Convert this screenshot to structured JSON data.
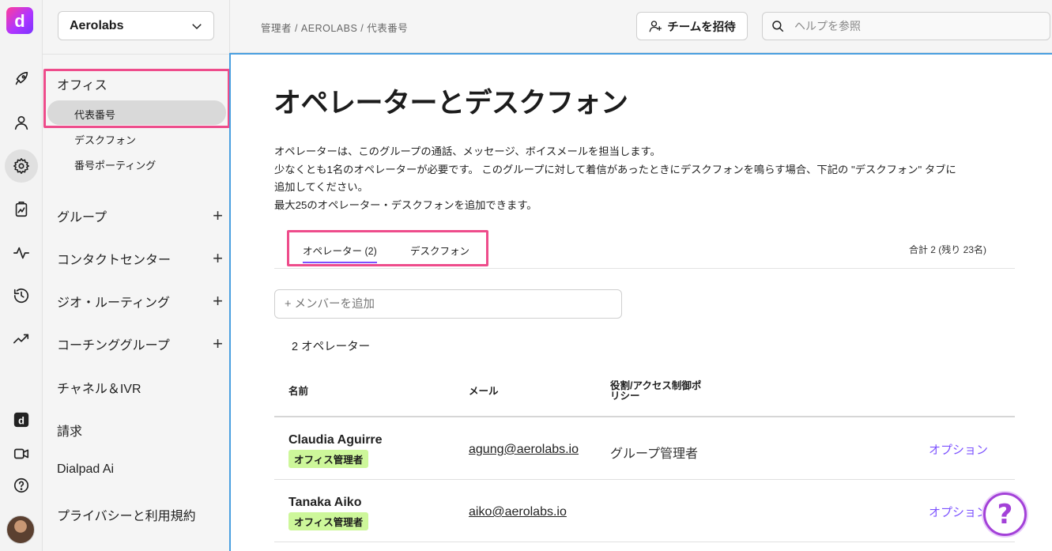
{
  "rail": {
    "logo_letter": "d"
  },
  "nav": {
    "org_name": "Aerolabs",
    "office_section": "オフィス",
    "office_items": [
      "代表番号",
      "デスクフォン",
      "番号ポーティング"
    ],
    "groups": [
      "グループ",
      "コンタクトセンター",
      "ジオ・ルーティング",
      "コーチンググループ"
    ],
    "links": [
      "チャネル＆IVR",
      "請求",
      "Dialpad Ai",
      "プライバシーと利用規約"
    ]
  },
  "topbar": {
    "breadcrumb": "管理者 / AEROLABS / 代表番号",
    "invite_label": "チームを招待",
    "help_placeholder": "ヘルプを参照"
  },
  "main": {
    "title": "オペレーターとデスクフォン",
    "desc_lines": [
      "オペレーターは、このグループの通話、メッセージ、ボイスメールを担当します。",
      "少なくとも1名のオペレーターが必要です。 このグループに対して着信があったときにデスクフォンを鳴らす場合、下記の \"デスクフォン\" タブに",
      "追加してください。",
      "最大25のオペレーター・デスクフォンを追加できます。"
    ],
    "tabs": [
      {
        "label": "オペレーター (2)"
      },
      {
        "label": "デスクフォン"
      }
    ],
    "total": "合計 2 (残り 23名)",
    "add_member_placeholder": "+ メンバーを追加",
    "operator_count": "2 オペレーター",
    "columns": {
      "name": "名前",
      "mail": "メール",
      "role_line1": "役割/アクセス制御ポ",
      "role_line2": "リシー"
    },
    "rows": [
      {
        "name": "Claudia Aguirre",
        "badge": "オフィス管理者",
        "email": "agung@aerolabs.io",
        "role": "グループ管理者",
        "option": "オプション"
      },
      {
        "name": "Tanaka Aiko",
        "badge": "オフィス管理者",
        "email": "aiko@aerolabs.io",
        "role": "",
        "option": "オプション"
      }
    ]
  },
  "help_fab": "?",
  "colors": {
    "accent": "#7c52ff",
    "highlight_box": "#ee4c8b",
    "badge_bg": "#cdf79a",
    "fab": "#a341d8"
  }
}
